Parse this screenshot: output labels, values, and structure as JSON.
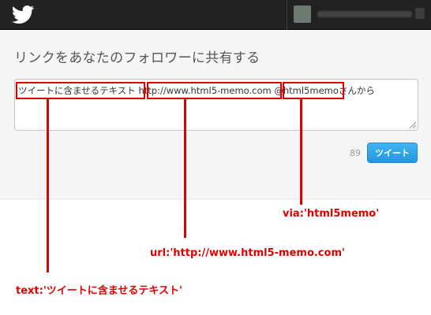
{
  "topbar": {
    "logo_icon": "twitter-bird-icon",
    "bg_color": "#222222"
  },
  "panel": {
    "title": "リンクをあなたのフォロワーに共有する"
  },
  "tweet": {
    "text": "ツイートに含ませるテキスト http://www.html5-memo.com @html5memoさんから",
    "char_count": "89",
    "button_label": "ツイート"
  },
  "annotations": {
    "text_label": "text:'ツイートに含ませるテキスト'",
    "url_label": "url:'http://www.html5-memo.com'",
    "via_label": "via:'html5memo'",
    "color": "#e00000"
  }
}
